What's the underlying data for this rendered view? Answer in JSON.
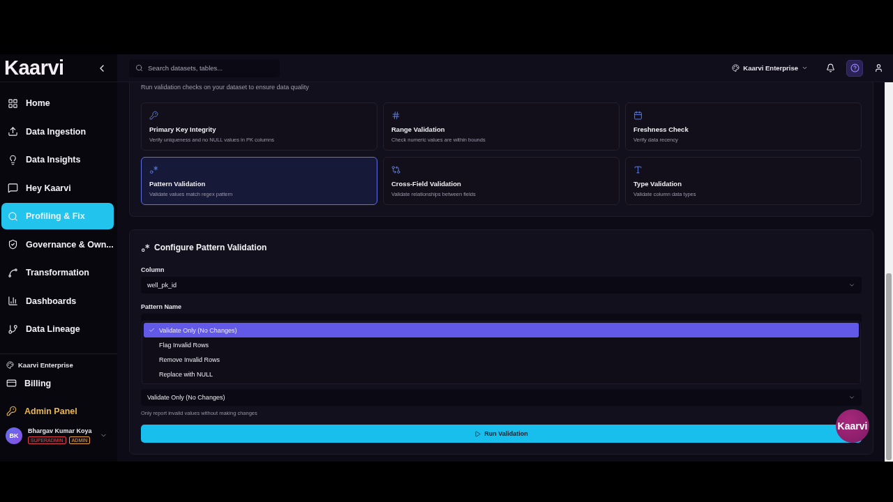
{
  "sidebar": {
    "logo": "Kaarvi",
    "items": [
      {
        "label": "Home",
        "selected": false
      },
      {
        "label": "Data Ingestion",
        "selected": false
      },
      {
        "label": "Data Insights",
        "selected": false
      },
      {
        "label": "Hey Kaarvi",
        "selected": false
      },
      {
        "label": "Profiling & Fix",
        "selected": true
      },
      {
        "label": "Governance & Own...",
        "selected": false
      },
      {
        "label": "Transformation",
        "selected": false
      },
      {
        "label": "Dashboards",
        "selected": false
      },
      {
        "label": "Data Lineage",
        "selected": false
      }
    ],
    "org": "Kaarvi Enterprise",
    "footer_items": [
      {
        "label": "Billing",
        "kind": "normal"
      },
      {
        "label": "Admin Panel",
        "kind": "admin"
      }
    ],
    "user": {
      "initials": "BK",
      "name": "Bhargav Kumar Koya",
      "roles": [
        {
          "label": "SUPERADMIN",
          "color": "#e0444f"
        },
        {
          "label": "ADMIN",
          "color": "#e8a33c"
        }
      ]
    }
  },
  "topbar": {
    "search": {
      "placeholder": "Search datasets, tables..."
    },
    "org": "Kaarvi Enterprise"
  },
  "validation": {
    "subtitle": "Run validation checks on your dataset to ensure data quality",
    "checks": [
      {
        "title": "Primary Key Integrity",
        "description": "Verify uniqueness and no NULL values in PK columns",
        "selected": false
      },
      {
        "title": "Range Validation",
        "description": "Check numeric values are within bounds",
        "selected": false
      },
      {
        "title": "Freshness Check",
        "description": "Verify data recency",
        "selected": false
      },
      {
        "title": "Pattern Validation",
        "description": "Validate values match regex pattern",
        "selected": true
      },
      {
        "title": "Cross-Field Validation",
        "description": "Validate relationships between fields",
        "selected": false
      },
      {
        "title": "Type Validation",
        "description": "Validate column data types",
        "selected": false
      }
    ]
  },
  "configure": {
    "title": "Configure Pattern Validation",
    "column": {
      "label": "Column",
      "value": "well_pk_id"
    },
    "pattern": {
      "label": "Pattern Name"
    },
    "options": [
      {
        "label": "Validate Only (No Changes)",
        "selected": true
      },
      {
        "label": "Flag Invalid Rows",
        "selected": false
      },
      {
        "label": "Remove Invalid Rows",
        "selected": false
      },
      {
        "label": "Replace with NULL",
        "selected": false
      }
    ],
    "action": {
      "value": "Validate Only (No Changes)",
      "hint": "Only report invalid values without making changes"
    },
    "run_button": "Run Validation"
  },
  "assistant_badge": "Kaarvi"
}
